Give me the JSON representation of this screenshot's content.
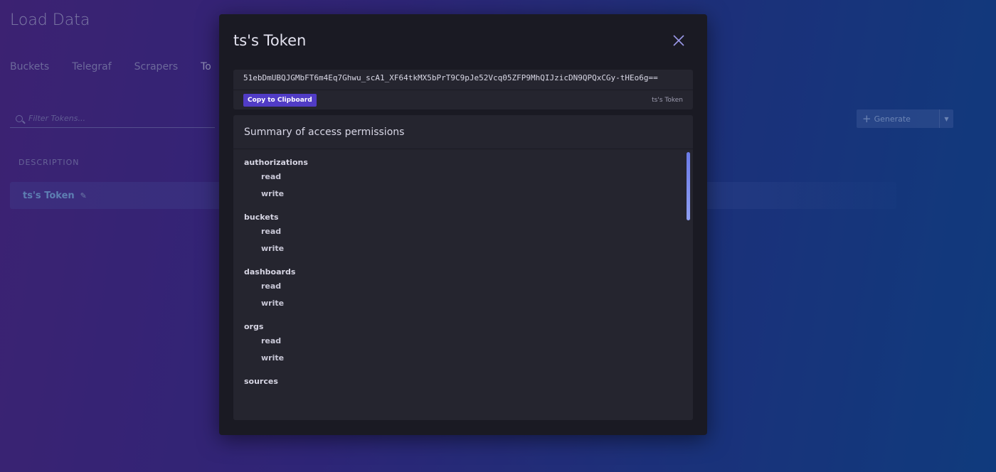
{
  "page": {
    "title": "Load Data",
    "tabs": [
      "Buckets",
      "Telegraf",
      "Scrapers",
      "To"
    ],
    "filter_placeholder": "Filter Tokens...",
    "generate_label": "Generate",
    "column_header": "DESCRIPTION",
    "token_row_name": "ts's Token"
  },
  "modal": {
    "title": "ts's Token",
    "token": "51ebDmUBQJGMbFT6m4Eq7Ghwu_scA1_XF64tkMX5bPrT9C9pJe52Vcq05ZFP9MhQIJzicDN9QPQxCGy-tHEo6g==",
    "copy_label": "Copy to Clipboard",
    "token_caption": "ts's Token",
    "permissions_header": "Summary of access permissions",
    "permissions": [
      {
        "resource": "authorizations",
        "actions": [
          "read",
          "write"
        ]
      },
      {
        "resource": "buckets",
        "actions": [
          "read",
          "write"
        ]
      },
      {
        "resource": "dashboards",
        "actions": [
          "read",
          "write"
        ]
      },
      {
        "resource": "orgs",
        "actions": [
          "read",
          "write"
        ]
      },
      {
        "resource": "sources",
        "actions": []
      }
    ]
  },
  "icons": {
    "close": "close-icon",
    "search": "search-icon",
    "plus": "plus-icon",
    "pencil": "pencil-icon",
    "caret": "chevron-down-icon"
  },
  "colors": {
    "copy_button": "#513cc6",
    "modal_bg": "#1a1a23",
    "panel_bg": "#25252f",
    "scrollbar": "#7b8bee"
  }
}
